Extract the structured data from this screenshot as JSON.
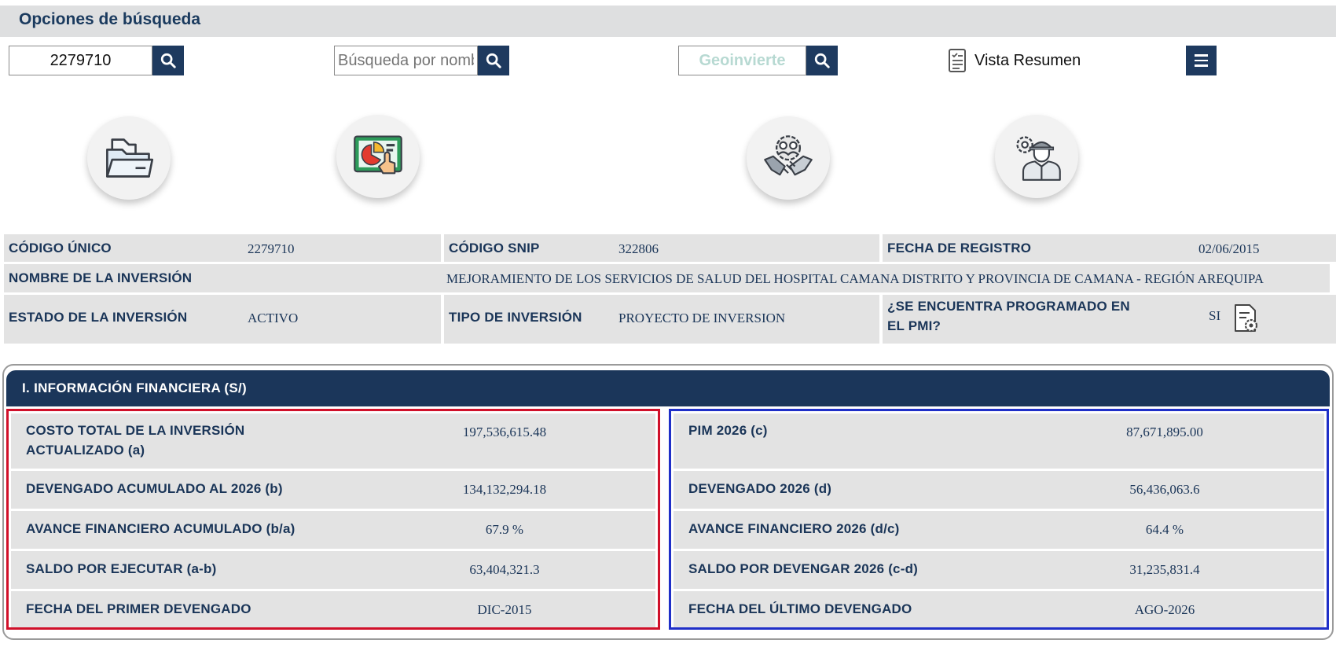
{
  "search": {
    "title": "Opciones de búsqueda",
    "code_value": "2279710",
    "name_placeholder": "Búsqueda por nombre",
    "geo_label": "Geoinvierte",
    "vista_label": "Vista Resumen"
  },
  "icons": [
    "folder-icon",
    "chart-presentation-icon",
    "handshake-icon",
    "engineer-icon"
  ],
  "info": {
    "codigo_unico_label": "CÓDIGO ÚNICO",
    "codigo_unico_value": "2279710",
    "codigo_snip_label": "CÓDIGO SNIP",
    "codigo_snip_value": "322806",
    "fecha_registro_label": "FECHA DE REGISTRO",
    "fecha_registro_value": "02/06/2015",
    "nombre_label": "NOMBRE DE LA INVERSIÓN",
    "nombre_value": "MEJORAMIENTO DE LOS SERVICIOS DE SALUD DEL HOSPITAL CAMANA DISTRITO Y PROVINCIA DE CAMANA - REGIÓN AREQUIPA",
    "estado_label": "ESTADO DE LA INVERSIÓN",
    "estado_value": "ACTIVO",
    "tipo_label": "TIPO DE INVERSIÓN",
    "tipo_value": "PROYECTO DE INVERSION",
    "pmi_label_1": "¿SE ENCUENTRA PROGRAMADO EN",
    "pmi_label_2": "EL PMI?",
    "pmi_value": "SI"
  },
  "financial": {
    "header": "I. INFORMACIÓN FINANCIERA (S/)",
    "left": [
      {
        "label_1": "COSTO TOTAL DE LA INVERSIÓN",
        "label_2": "ACTUALIZADO (a)",
        "value": "197,536,615.48"
      },
      {
        "label_1": "DEVENGADO ACUMULADO AL 2026 (b)",
        "label_2": "",
        "value": "134,132,294.18"
      },
      {
        "label_1": "AVANCE FINANCIERO ACUMULADO (b/a)",
        "label_2": "",
        "value": "67.9 %"
      },
      {
        "label_1": "SALDO POR EJECUTAR (a-b)",
        "label_2": "",
        "value": "63,404,321.3"
      },
      {
        "label_1": "FECHA DEL PRIMER DEVENGADO",
        "label_2": "",
        "value": "DIC-2015"
      }
    ],
    "right": [
      {
        "label_1": "PIM 2026 (c)",
        "label_2": "",
        "value": "87,671,895.00"
      },
      {
        "label_1": "DEVENGADO 2026 (d)",
        "label_2": "",
        "value": "56,436,063.6"
      },
      {
        "label_1": "AVANCE FINANCIERO 2026 (d/c)",
        "label_2": "",
        "value": "64.4 %"
      },
      {
        "label_1": "SALDO POR DEVENGAR 2026 (c-d)",
        "label_2": "",
        "value": "31,235,831.4"
      },
      {
        "label_1": "FECHA DEL ÚLTIMO DEVENGADO",
        "label_2": "",
        "value": "AGO-2026"
      }
    ]
  },
  "colors": {
    "navy": "#1b365a",
    "red_border": "#d0102a",
    "blue_border": "#1f2fc8",
    "cell_bg": "#e3e3e3"
  }
}
